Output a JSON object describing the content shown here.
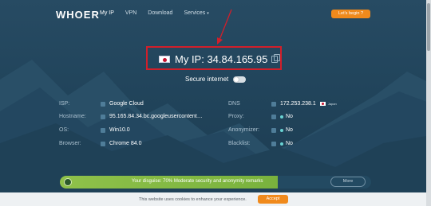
{
  "header": {
    "logo": "WHOER",
    "nav": [
      {
        "label": "My IP"
      },
      {
        "label": "VPN"
      },
      {
        "label": "Download"
      },
      {
        "label": "Services"
      }
    ],
    "cta_label": "Let's begin ?"
  },
  "ip": {
    "label": "My IP: 34.84.165.95",
    "flag": "japan-flag-icon"
  },
  "secure": {
    "label": "Secure internet"
  },
  "info": {
    "left": [
      {
        "key": "ISP:",
        "value": "Google Cloud"
      },
      {
        "key": "Hostname:",
        "value": "95.165.84.34.bc.googleusercontent…"
      },
      {
        "key": "OS:",
        "value": "Win10.0"
      },
      {
        "key": "Browser:",
        "value": "Chrome 84.0"
      }
    ],
    "right": [
      {
        "key": "DNS",
        "value": "172.253.238.1",
        "country": "Japan"
      },
      {
        "key": "Proxy:",
        "value": "No"
      },
      {
        "key": "Anonymizer:",
        "value": "No"
      },
      {
        "key": "Blacklist:",
        "value": "No"
      }
    ]
  },
  "disguise": {
    "text": "Your disguise: 70% Moderate security and anonymity remarks",
    "percent": 70,
    "more_label": "More"
  },
  "cookie": {
    "text": "This website uses cookies to enhance your experience.",
    "accept_label": "Accept"
  },
  "colors": {
    "accent": "#f08a1c",
    "annotation": "#d11f2a",
    "progress": "#8fc14a"
  }
}
